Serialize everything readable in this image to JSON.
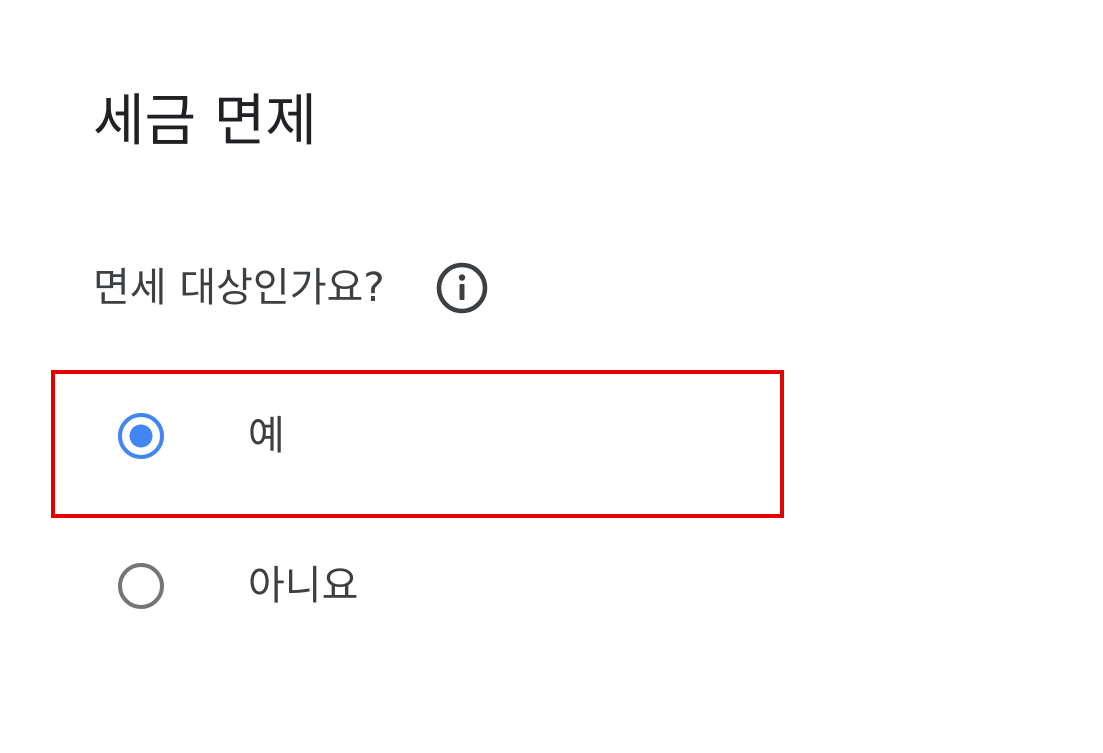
{
  "section": {
    "title": "세금 면제"
  },
  "question": {
    "label": "면세 대상인가요?",
    "info_icon": "info-icon"
  },
  "options": [
    {
      "label": "예",
      "selected": true
    },
    {
      "label": "아니요",
      "selected": false
    }
  ],
  "colors": {
    "selected_radio": "#4285f4",
    "unselected_radio": "#757575",
    "highlight_border": "#e60000",
    "text": "#3c4043"
  }
}
